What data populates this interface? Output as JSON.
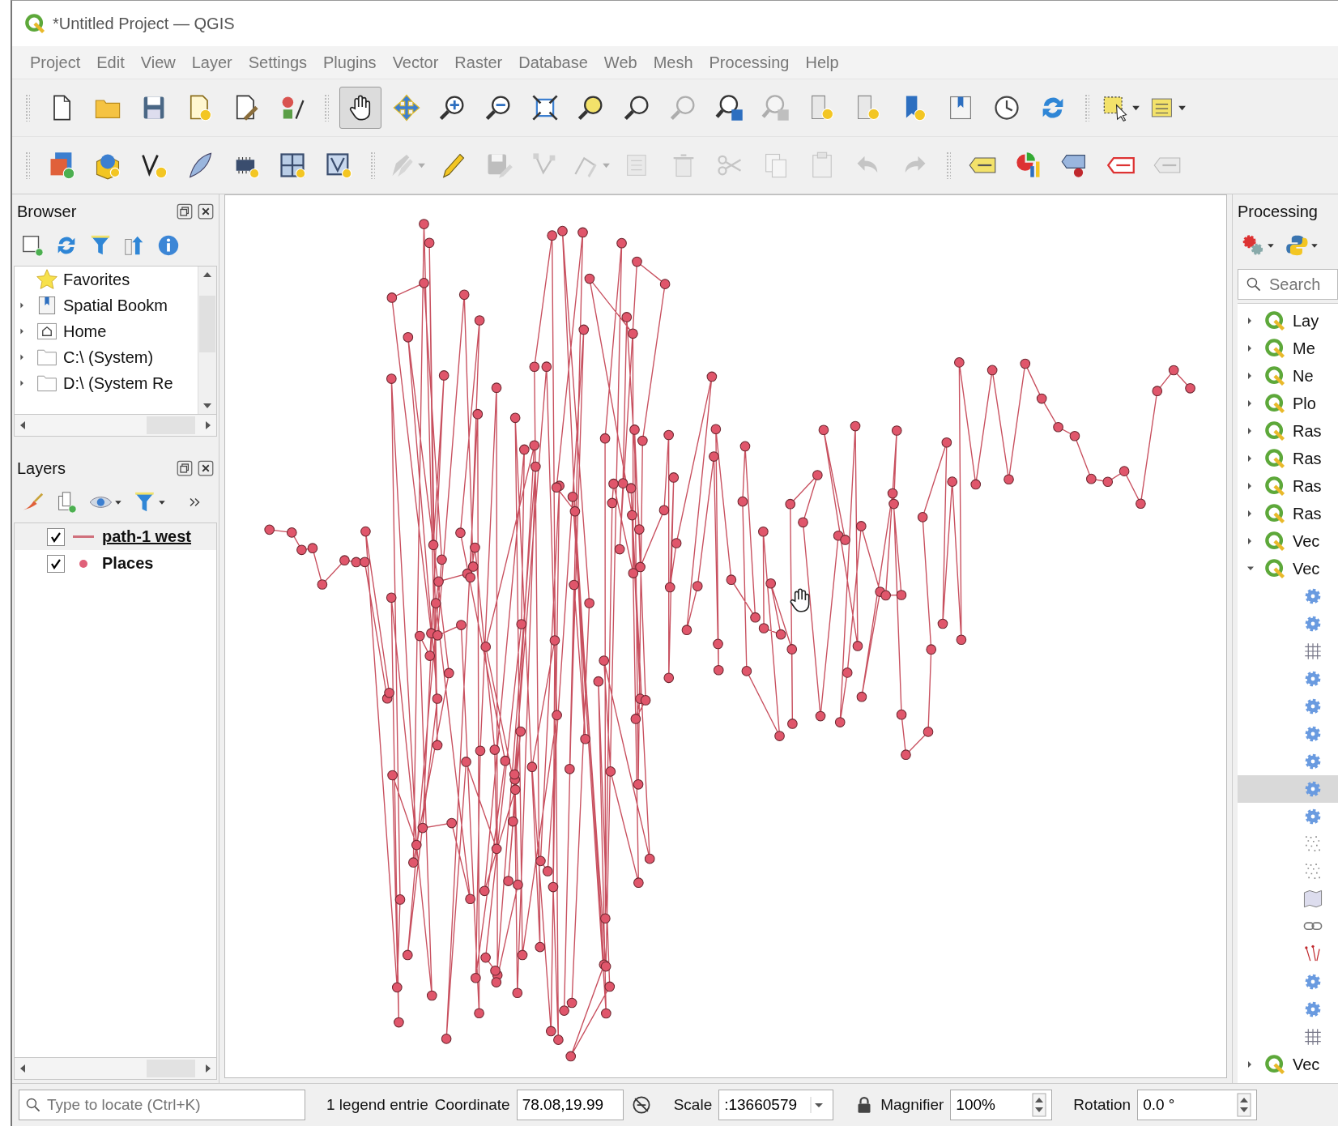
{
  "window": {
    "title": "*Untitled Project — QGIS"
  },
  "menu": [
    "Project",
    "Edit",
    "View",
    "Layer",
    "Settings",
    "Plugins",
    "Vector",
    "Raster",
    "Database",
    "Web",
    "Mesh",
    "Processing",
    "Help"
  ],
  "toolbars": [
    {
      "buttons": [
        {
          "selected": false,
          "disabled": false
        },
        {
          "selected": false,
          "disabled": false
        },
        {
          "selected": false,
          "disabled": false
        },
        {
          "selected": false,
          "disabled": false
        },
        {
          "selected": false,
          "disabled": false
        },
        {
          "selected": false,
          "disabled": false
        },
        {
          "selected": true,
          "disabled": false
        },
        {
          "selected": false,
          "disabled": false
        },
        {
          "selected": false,
          "disabled": false
        },
        {
          "selected": false,
          "disabled": false
        },
        {
          "selected": false,
          "disabled": false
        },
        {
          "selected": false,
          "disabled": false
        },
        {
          "selected": false,
          "disabled": false
        },
        {
          "selected": false,
          "disabled": true
        },
        {
          "selected": false,
          "disabled": false
        },
        {
          "selected": false,
          "disabled": true
        },
        {
          "selected": false,
          "disabled": false
        },
        {
          "selected": false,
          "disabled": false
        },
        {
          "selected": false,
          "disabled": false
        },
        {
          "selected": false,
          "disabled": false
        },
        {
          "selected": false,
          "disabled": false
        },
        {
          "selected": false,
          "disabled": false
        },
        {
          "selected": false,
          "disabled": false
        },
        {
          "selected": false,
          "disabled": false
        }
      ]
    },
    {
      "buttons": [
        {
          "selected": false,
          "disabled": false
        },
        {
          "selected": false,
          "disabled": false
        },
        {
          "selected": false,
          "disabled": false
        },
        {
          "selected": false,
          "disabled": false
        },
        {
          "selected": false,
          "disabled": false
        },
        {
          "selected": false,
          "disabled": false
        },
        {
          "selected": false,
          "disabled": false
        },
        {
          "selected": false,
          "disabled": true
        },
        {
          "selected": false,
          "disabled": false
        },
        {
          "selected": false,
          "disabled": true
        },
        {
          "selected": false,
          "disabled": true
        },
        {
          "selected": false,
          "disabled": true
        },
        {
          "selected": false,
          "disabled": true
        },
        {
          "selected": false,
          "disabled": true
        },
        {
          "selected": false,
          "disabled": true
        },
        {
          "selected": false,
          "disabled": true
        },
        {
          "selected": false,
          "disabled": true
        },
        {
          "selected": false,
          "disabled": true
        },
        {
          "selected": false,
          "disabled": true
        },
        {
          "selected": false,
          "disabled": false
        },
        {
          "selected": false,
          "disabled": false
        },
        {
          "selected": false,
          "disabled": false
        },
        {
          "selected": false,
          "disabled": false
        },
        {
          "selected": false,
          "disabled": true
        }
      ]
    }
  ],
  "browser": {
    "title": "Browser",
    "items": [
      {
        "label": "Favorites"
      },
      {
        "label": "Spatial Bookm",
        "expanded": false
      },
      {
        "label": "Home",
        "expanded": false
      },
      {
        "label": "C:\\ (System)",
        "expanded": false
      },
      {
        "label": "D:\\ (System Re",
        "expanded": false
      }
    ]
  },
  "layers": {
    "title": "Layers",
    "items": [
      {
        "label": "path-1 west",
        "kind": "line",
        "checked": true,
        "selected": true,
        "color": "#d0707c"
      },
      {
        "label": "Places",
        "kind": "point",
        "checked": true,
        "selected": false,
        "color": "#e06079"
      }
    ]
  },
  "processing": {
    "title": "Processing",
    "search": {
      "placeholder": "Search"
    },
    "items": [
      {
        "label": "Lay",
        "expanded": false
      },
      {
        "label": "Me",
        "expanded": false
      },
      {
        "label": "Ne",
        "expanded": false
      },
      {
        "label": "Plo",
        "expanded": false
      },
      {
        "label": "Ras",
        "expanded": false
      },
      {
        "label": "Ras",
        "expanded": false
      },
      {
        "label": "Ras",
        "expanded": false
      },
      {
        "label": "Ras",
        "expanded": false
      },
      {
        "label": "Vec",
        "expanded": false
      },
      {
        "label": "Vec",
        "expanded": true,
        "children": [
          {
            "selected": false
          },
          {
            "selected": false
          },
          {
            "selected": false
          },
          {
            "selected": false
          },
          {
            "selected": false
          },
          {
            "selected": false
          },
          {
            "selected": false
          },
          {
            "selected": true
          },
          {
            "selected": false
          },
          {
            "selected": false
          },
          {
            "selected": false
          },
          {
            "selected": false
          },
          {
            "selected": false
          },
          {
            "selected": false
          },
          {
            "selected": false
          },
          {
            "selected": false
          },
          {
            "selected": false
          }
        ]
      },
      {
        "label": "Vec",
        "expanded": false
      }
    ]
  },
  "status_bar": {
    "locator_placeholder": "Type to locate (Ctrl+K)",
    "legend": "1 legend entrie",
    "coordinate_label": "Coordinate",
    "coordinate": "78.08,19.99",
    "scale_label": "Scale",
    "scale": ":13660579",
    "magnifier_label": "Magnifier",
    "magnifier": "100%",
    "rotation_label": "Rotation",
    "rotation": "0.0 °"
  }
}
